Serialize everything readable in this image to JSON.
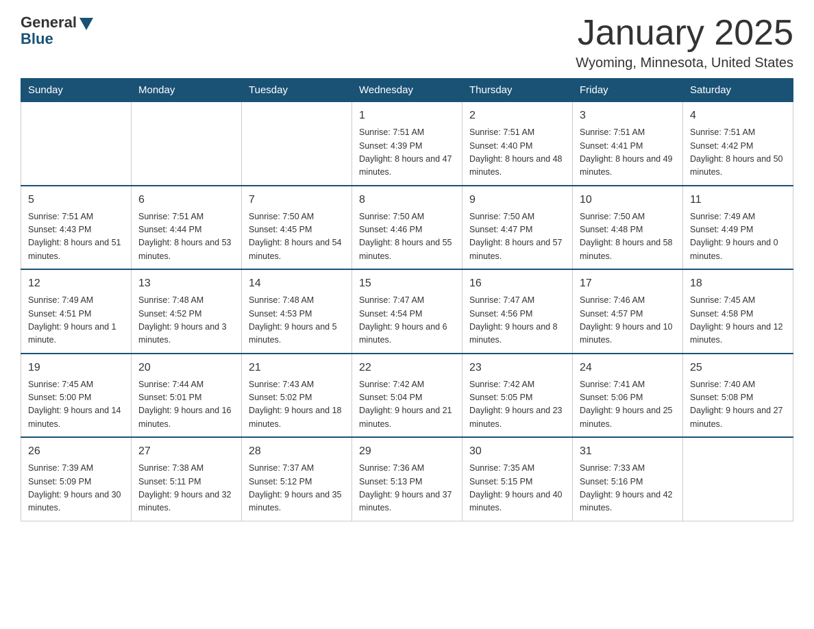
{
  "header": {
    "logo_general": "General",
    "logo_blue": "Blue",
    "month_title": "January 2025",
    "location": "Wyoming, Minnesota, United States"
  },
  "weekdays": [
    "Sunday",
    "Monday",
    "Tuesday",
    "Wednesday",
    "Thursday",
    "Friday",
    "Saturday"
  ],
  "weeks": [
    [
      {
        "day": "",
        "info": ""
      },
      {
        "day": "",
        "info": ""
      },
      {
        "day": "",
        "info": ""
      },
      {
        "day": "1",
        "info": "Sunrise: 7:51 AM\nSunset: 4:39 PM\nDaylight: 8 hours\nand 47 minutes."
      },
      {
        "day": "2",
        "info": "Sunrise: 7:51 AM\nSunset: 4:40 PM\nDaylight: 8 hours\nand 48 minutes."
      },
      {
        "day": "3",
        "info": "Sunrise: 7:51 AM\nSunset: 4:41 PM\nDaylight: 8 hours\nand 49 minutes."
      },
      {
        "day": "4",
        "info": "Sunrise: 7:51 AM\nSunset: 4:42 PM\nDaylight: 8 hours\nand 50 minutes."
      }
    ],
    [
      {
        "day": "5",
        "info": "Sunrise: 7:51 AM\nSunset: 4:43 PM\nDaylight: 8 hours\nand 51 minutes."
      },
      {
        "day": "6",
        "info": "Sunrise: 7:51 AM\nSunset: 4:44 PM\nDaylight: 8 hours\nand 53 minutes."
      },
      {
        "day": "7",
        "info": "Sunrise: 7:50 AM\nSunset: 4:45 PM\nDaylight: 8 hours\nand 54 minutes."
      },
      {
        "day": "8",
        "info": "Sunrise: 7:50 AM\nSunset: 4:46 PM\nDaylight: 8 hours\nand 55 minutes."
      },
      {
        "day": "9",
        "info": "Sunrise: 7:50 AM\nSunset: 4:47 PM\nDaylight: 8 hours\nand 57 minutes."
      },
      {
        "day": "10",
        "info": "Sunrise: 7:50 AM\nSunset: 4:48 PM\nDaylight: 8 hours\nand 58 minutes."
      },
      {
        "day": "11",
        "info": "Sunrise: 7:49 AM\nSunset: 4:49 PM\nDaylight: 9 hours\nand 0 minutes."
      }
    ],
    [
      {
        "day": "12",
        "info": "Sunrise: 7:49 AM\nSunset: 4:51 PM\nDaylight: 9 hours\nand 1 minute."
      },
      {
        "day": "13",
        "info": "Sunrise: 7:48 AM\nSunset: 4:52 PM\nDaylight: 9 hours\nand 3 minutes."
      },
      {
        "day": "14",
        "info": "Sunrise: 7:48 AM\nSunset: 4:53 PM\nDaylight: 9 hours\nand 5 minutes."
      },
      {
        "day": "15",
        "info": "Sunrise: 7:47 AM\nSunset: 4:54 PM\nDaylight: 9 hours\nand 6 minutes."
      },
      {
        "day": "16",
        "info": "Sunrise: 7:47 AM\nSunset: 4:56 PM\nDaylight: 9 hours\nand 8 minutes."
      },
      {
        "day": "17",
        "info": "Sunrise: 7:46 AM\nSunset: 4:57 PM\nDaylight: 9 hours\nand 10 minutes."
      },
      {
        "day": "18",
        "info": "Sunrise: 7:45 AM\nSunset: 4:58 PM\nDaylight: 9 hours\nand 12 minutes."
      }
    ],
    [
      {
        "day": "19",
        "info": "Sunrise: 7:45 AM\nSunset: 5:00 PM\nDaylight: 9 hours\nand 14 minutes."
      },
      {
        "day": "20",
        "info": "Sunrise: 7:44 AM\nSunset: 5:01 PM\nDaylight: 9 hours\nand 16 minutes."
      },
      {
        "day": "21",
        "info": "Sunrise: 7:43 AM\nSunset: 5:02 PM\nDaylight: 9 hours\nand 18 minutes."
      },
      {
        "day": "22",
        "info": "Sunrise: 7:42 AM\nSunset: 5:04 PM\nDaylight: 9 hours\nand 21 minutes."
      },
      {
        "day": "23",
        "info": "Sunrise: 7:42 AM\nSunset: 5:05 PM\nDaylight: 9 hours\nand 23 minutes."
      },
      {
        "day": "24",
        "info": "Sunrise: 7:41 AM\nSunset: 5:06 PM\nDaylight: 9 hours\nand 25 minutes."
      },
      {
        "day": "25",
        "info": "Sunrise: 7:40 AM\nSunset: 5:08 PM\nDaylight: 9 hours\nand 27 minutes."
      }
    ],
    [
      {
        "day": "26",
        "info": "Sunrise: 7:39 AM\nSunset: 5:09 PM\nDaylight: 9 hours\nand 30 minutes."
      },
      {
        "day": "27",
        "info": "Sunrise: 7:38 AM\nSunset: 5:11 PM\nDaylight: 9 hours\nand 32 minutes."
      },
      {
        "day": "28",
        "info": "Sunrise: 7:37 AM\nSunset: 5:12 PM\nDaylight: 9 hours\nand 35 minutes."
      },
      {
        "day": "29",
        "info": "Sunrise: 7:36 AM\nSunset: 5:13 PM\nDaylight: 9 hours\nand 37 minutes."
      },
      {
        "day": "30",
        "info": "Sunrise: 7:35 AM\nSunset: 5:15 PM\nDaylight: 9 hours\nand 40 minutes."
      },
      {
        "day": "31",
        "info": "Sunrise: 7:33 AM\nSunset: 5:16 PM\nDaylight: 9 hours\nand 42 minutes."
      },
      {
        "day": "",
        "info": ""
      }
    ]
  ]
}
